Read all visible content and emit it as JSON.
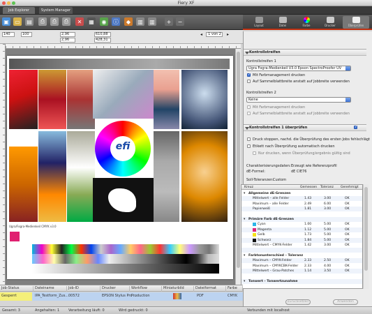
{
  "window": {
    "title": "Fiery XF"
  },
  "tabs": [
    {
      "label": "Job Explorer"
    },
    {
      "label": "System Manager"
    }
  ],
  "measure": {
    "copies": "140",
    "zoom": "100",
    "x_offset": "2,96",
    "y_offset": "2,96",
    "width": "610,88",
    "height": "428,31",
    "page_counter": "1 von 2"
  },
  "panel_tabs": [
    {
      "label": "Layout"
    },
    {
      "label": "Datei"
    },
    {
      "label": "Farbe"
    },
    {
      "label": "Drucker"
    },
    {
      "label": "Überprüfen"
    }
  ],
  "panel": {
    "kontrollstreifen_title": "Kontrollstreifen",
    "kontrollstreifen1_label": "Kontrollstreifen 1",
    "kontrollstreifen1_value": "Ugra Fogra-Medienkeil V3.0 Epson SpectroProofer UV",
    "farbmanagement1": "Mit Farbmanagement drucken",
    "sammelblatt1": "Auf Sammelblattbreite anstatt auf Jobbreite verwenden",
    "kontrollstreifen2_label": "Kontrollstreifen 2",
    "kontrollstreifen2_value": "Keine",
    "farbmanagement2": "Mit Farbmanagement drucken",
    "sammelblatt2": "Auf Sammelblattbreite anstatt auf Jobbreite verwenden",
    "ueberpruefen_title": "Kontrollstreifen 1 überprüfen",
    "check1": "Druck stoppen, nachd. die Überprüfung des ersten Jobs fehlschlägt",
    "check2": "Etikett nach Überprüfung automatisch drucken",
    "check3": "Nur drucken, wenn Überprüfung/ergebnis gültig sind",
    "charakterisierung_label": "Charakterisierungsdaten:",
    "charakterisierung_value": "Erzeugt wie Referenzprofil",
    "de_formel_label": "dE-Formel:",
    "de_formel_value": "dE CIE76",
    "soll_label": "Soll-Toleranzen:",
    "soll_value": "Custom",
    "table_headers": {
      "a": "Kreuz",
      "b": "Gemessen",
      "c": "Toleranz",
      "d": "Genehmigt"
    },
    "rows": [
      {
        "type": "grp",
        "a": "Allgemeine dE-Grenzen",
        "b": "",
        "c": "",
        "d": ""
      },
      {
        "type": "row",
        "a": "Mittelwert – alle Felder",
        "b": "1.43",
        "c": "3.00",
        "d": "OK"
      },
      {
        "type": "row",
        "a": "Maximum – alle Felder",
        "b": "2.49",
        "c": "6.00",
        "d": "OK"
      },
      {
        "type": "row",
        "a": "Papierweiß",
        "b": "1.81",
        "c": "3.00",
        "d": "OK"
      },
      {
        "type": "gap",
        "a": "",
        "b": "",
        "c": "",
        "d": ""
      },
      {
        "type": "grp",
        "a": "Primäre Farb dE-Grenzen",
        "b": "",
        "c": "",
        "d": ""
      },
      {
        "type": "sw",
        "color": "#2cb5e8",
        "a": "Cyan",
        "b": "1.00",
        "c": "5.00",
        "d": "OK"
      },
      {
        "type": "sw",
        "color": "#e0247a",
        "a": "Magenta",
        "b": "1.12",
        "c": "5.00",
        "d": "OK"
      },
      {
        "type": "sw",
        "color": "#f5e21a",
        "a": "Gelb",
        "b": "1.73",
        "c": "5.00",
        "d": "OK"
      },
      {
        "type": "sw",
        "color": "#111111",
        "a": "Schwarz",
        "b": "1.84",
        "c": "5.00",
        "d": "OK"
      },
      {
        "type": "row",
        "a": "Mittelwert – CMYK-Felder",
        "b": "1.42",
        "c": "3.00",
        "d": "OK"
      },
      {
        "type": "gap",
        "a": "",
        "b": "",
        "c": "",
        "d": ""
      },
      {
        "type": "grp",
        "a": "Farbtonunterschied – Toleranz",
        "b": "",
        "c": "",
        "d": ""
      },
      {
        "type": "row",
        "a": "Maximum – CMYK-Felder",
        "b": "2.33",
        "c": "2.50",
        "d": "OK"
      },
      {
        "type": "row",
        "a": "Maximum – CMYKCBK-Felder",
        "b": "2.33",
        "c": "4.00",
        "d": "OK"
      },
      {
        "type": "row",
        "a": "Mittelwert – Grau-Patches",
        "b": "1.14",
        "c": "3.50",
        "d": "OK"
      },
      {
        "type": "gap",
        "a": "",
        "b": "",
        "c": "",
        "d": ""
      },
      {
        "type": "grp",
        "a": "Tonwert – Tonwertzunahme",
        "b": "",
        "c": "",
        "d": ""
      }
    ],
    "btn_left": "Zurücksetzen",
    "btn_right": "Anwenden"
  },
  "job_columns": [
    "Job-Status",
    "Dateiname",
    "Job-ID",
    "Drucker",
    "Workflow",
    "Miniaturbild",
    "Dateiformat",
    "Farbe"
  ],
  "job_row": {
    "status": "Gesperrt",
    "file": "IPA_Testform_Zus...",
    "id": "00572",
    "printer": "EPSON Stylus Pro ...",
    "workflow": "Production",
    "format": "PDF",
    "color": "CMYK"
  },
  "status": {
    "total": "Gesamt: 3",
    "halted": "Angehalten: 1",
    "processing": "Verarbeitung läuft: 0",
    "printing": "Wird gedruckt: 0",
    "connection": "Verbunden mit localhost"
  },
  "sheet_caption": "Ugra/Fogra-Medienkeil CMYK v3.0",
  "logo_text": "efi",
  "colors": {
    "accent": "#c03010",
    "selection": "#bcd3f0",
    "panel": "#ececec"
  }
}
